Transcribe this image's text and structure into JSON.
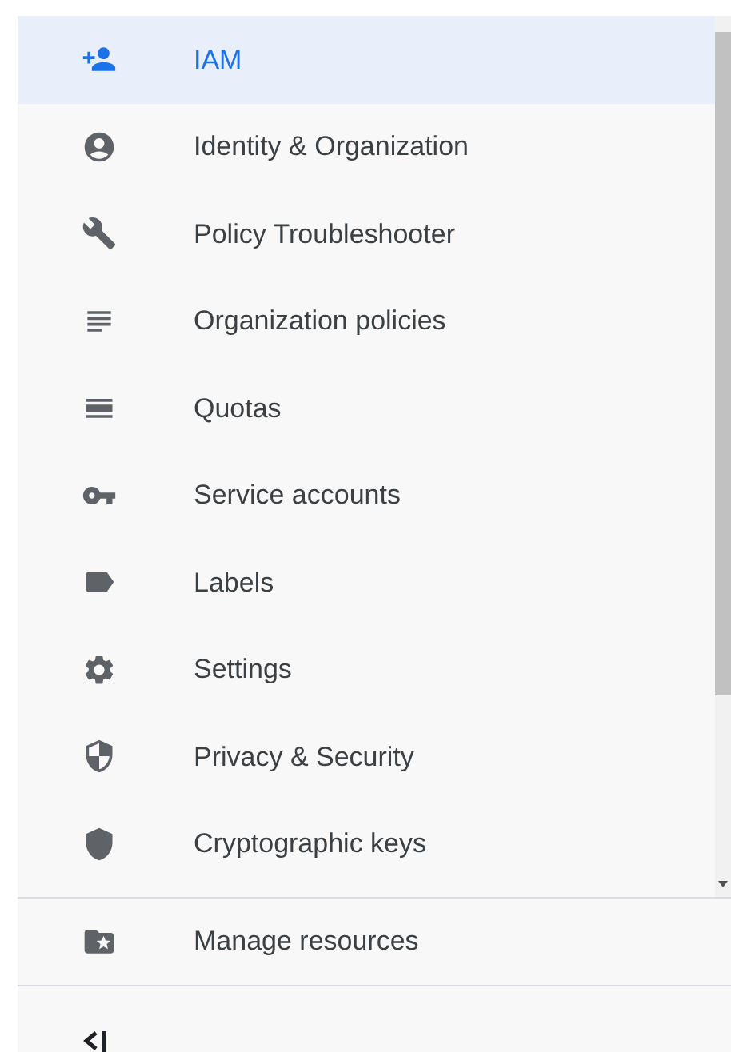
{
  "nav_items": [
    {
      "label": "IAM",
      "selected": true
    },
    {
      "label": "Identity & Organization",
      "selected": false
    },
    {
      "label": "Policy Troubleshooter",
      "selected": false
    },
    {
      "label": "Organization policies",
      "selected": false
    },
    {
      "label": "Quotas",
      "selected": false
    },
    {
      "label": "Service accounts",
      "selected": false
    },
    {
      "label": "Labels",
      "selected": false
    },
    {
      "label": "Settings",
      "selected": false
    },
    {
      "label": "Privacy & Security",
      "selected": false
    },
    {
      "label": "Cryptographic keys",
      "selected": false
    }
  ],
  "footer_item": {
    "label": "Manage resources",
    "selected": false
  }
}
